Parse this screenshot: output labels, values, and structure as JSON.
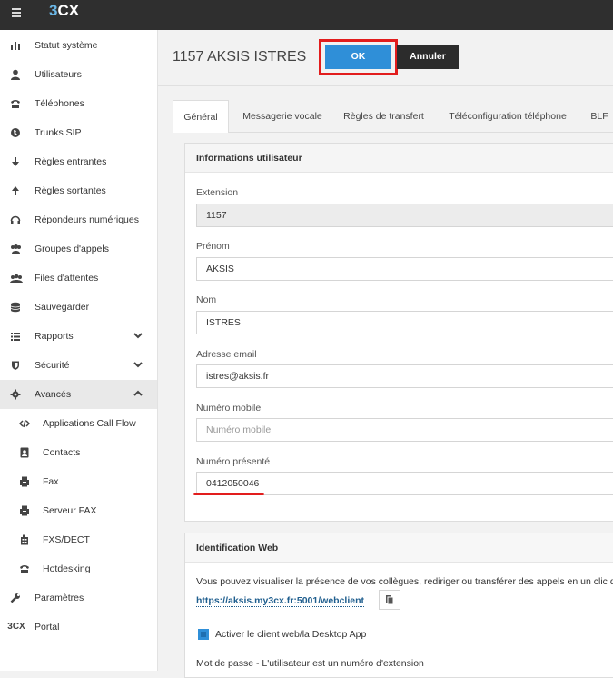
{
  "app": {
    "logo": "3CX"
  },
  "sidebar": {
    "items": [
      {
        "label": "Statut système",
        "icon": "bar-chart-icon"
      },
      {
        "label": "Utilisateurs",
        "icon": "user-icon"
      },
      {
        "label": "Téléphones",
        "icon": "phone-icon"
      },
      {
        "label": "Trunks SIP",
        "icon": "globe-icon"
      },
      {
        "label": "Règles entrantes",
        "icon": "arrow-down-icon"
      },
      {
        "label": "Règles sortantes",
        "icon": "arrow-up-icon"
      },
      {
        "label": "Répondeurs numériques",
        "icon": "headset-icon"
      },
      {
        "label": "Groupes d'appels",
        "icon": "users-icon"
      },
      {
        "label": "Files d'attentes",
        "icon": "queue-icon"
      },
      {
        "label": "Sauvegarder",
        "icon": "database-icon"
      },
      {
        "label": "Rapports",
        "icon": "list-icon"
      },
      {
        "label": "Sécurité",
        "icon": "shield-icon"
      },
      {
        "label": "Avancés",
        "icon": "gear-icon"
      },
      {
        "label": "Applications Call Flow",
        "icon": "code-icon"
      },
      {
        "label": "Contacts",
        "icon": "contact-card-icon"
      },
      {
        "label": "Fax",
        "icon": "fax-icon"
      },
      {
        "label": "Serveur FAX",
        "icon": "fax-server-icon"
      },
      {
        "label": "FXS/DECT",
        "icon": "fxs-icon"
      },
      {
        "label": "Hotdesking",
        "icon": "hotdesk-phone-icon"
      },
      {
        "label": "Paramètres",
        "icon": "wrench-icon"
      },
      {
        "label": "Portal",
        "icon": "3cx-icon",
        "icon_text": "3CX"
      }
    ]
  },
  "header": {
    "title": "1157 AKSIS ISTRES",
    "ok_label": "OK",
    "cancel_label": "Annuler"
  },
  "tabs": [
    "Général",
    "Messagerie vocale",
    "Règles de transfert",
    "Téléconfiguration téléphone",
    "BLF"
  ],
  "user_info": {
    "heading": "Informations utilisateur",
    "extension_label": "Extension",
    "extension_value": "1157",
    "firstname_label": "Prénom",
    "firstname_value": "AKSIS",
    "lastname_label": "Nom",
    "lastname_value": "ISTRES",
    "email_label": "Adresse email",
    "email_value": "istres@aksis.fr",
    "mobile_label": "Numéro mobile",
    "mobile_placeholder": "Numéro mobile",
    "presented_label": "Numéro présenté",
    "presented_value": "0412050046"
  },
  "web_ident": {
    "heading": "Identification Web",
    "description": "Vous pouvez visualiser la présence de vos collègues, rediriger ou transférer des appels en un clic de",
    "url": "https://aksis.my3cx.fr:5001/webclient",
    "checkbox_label": "Activer le client web/la Desktop App",
    "password_text": "Mot de passe - L'utilisateur est un numéro d'extension"
  },
  "colors": {
    "accent": "#2f8fd8",
    "highlight": "#e21d1d",
    "topbar": "#2f2f2f"
  }
}
